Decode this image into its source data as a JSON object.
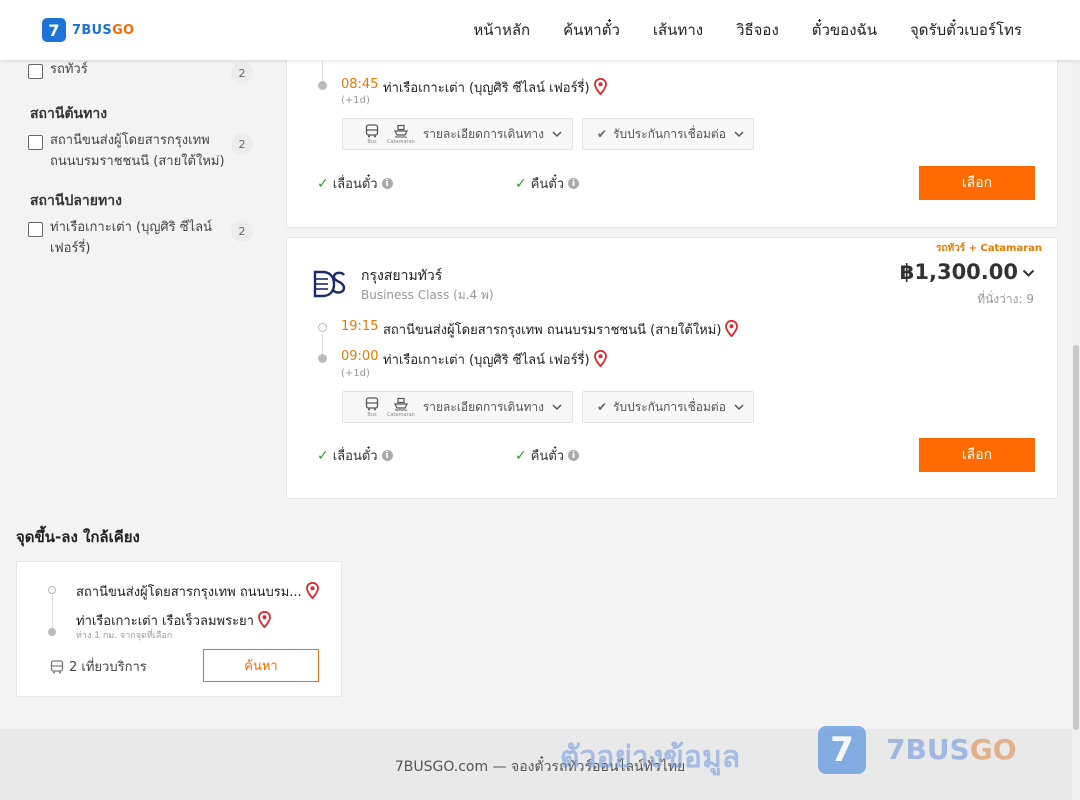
{
  "brand": {
    "logo_mark": "7",
    "name_part1": "7BUS",
    "name_part2": "GO"
  },
  "nav": [
    "หน้าหลัก",
    "ค้นหาตั๋ว",
    "เส้นทาง",
    "วิธีจอง",
    "ตั๋วของฉัน",
    "จุดรับตั๋วเบอร์โทร"
  ],
  "filters": {
    "tour_bus": {
      "label": "รถทัวร์",
      "count": "2"
    },
    "origin_heading": "สถานีต้นทาง",
    "origin": {
      "label": "สถานีขนส่งผู้โดยสารกรุงเทพ ถนนบรมราชชนนี (สายใต้ใหม่)",
      "count": "2"
    },
    "dest_heading": "สถานีปลายทาง",
    "destination": {
      "label": "ท่าเรือเกาะเต่า (บุญศิริ ซีไลน์ เฟอร์รี่)",
      "count": "2"
    }
  },
  "card1": {
    "arrive_time": "08:45",
    "arrive_stop": "ท่าเรือเกาะเต่า (บุญศิริ ซีไลน์ เฟอร์รี่)",
    "next_day": "(+1d)",
    "bus_label": "Bus",
    "boat_label": "Catamaran",
    "details_label": "รายละเอียดการเดินทาง",
    "insurance_label": "รับประกันการเชื่อมต่อ",
    "reschedule": "เลื่อนตั๋ว",
    "refund": "คืนตั๋ว",
    "select": "เลือก"
  },
  "card2": {
    "tag": "รถทัวร์ + Catamaran",
    "operator": "กรุงสยามทัวร์",
    "class": "Business Class (ม.4 พ)",
    "price": "฿1,300.00",
    "seats": "ที่นั่งว่าง: 9",
    "depart_time": "19:15",
    "depart_stop": "สถานีขนส่งผู้โดยสารกรุงเทพ ถนนบรมราชชนนี (สายใต้ใหม่)",
    "arrive_time": "09:00",
    "arrive_stop": "ท่าเรือเกาะเต่า (บุญศิริ ซีไลน์ เฟอร์รี่)",
    "next_day": "(+1d)",
    "bus_label": "Bus",
    "boat_label": "Catamaran",
    "details_label": "รายละเอียดการเดินทาง",
    "insurance_label": "รับประกันการเชื่อมต่อ",
    "reschedule": "เลื่อนตั๋ว",
    "refund": "คืนตั๋ว",
    "select": "เลือก"
  },
  "nearby": {
    "title": "จุดขึ้น-ลง ใกล้เคียง",
    "from_stop": "สถานีขนส่งผู้โดยสารกรุงเทพ ถนนบรม...",
    "to_stop": "ท่าเรือเกาะเต่า เรือเร็วลมพระยา",
    "distance_note": "ห่าง 1 กม. จากจุดที่เลือก",
    "trips": "2 เที่ยวบริการ",
    "search": "ค้นหา"
  },
  "footer": {
    "text": "7BUSGO.com — จองตั๋วรถทัวร์ออนไลน์ทั่วไทย",
    "watermark": "ตัวอย่างข้อมูล",
    "watermark_logo_mark": "7",
    "watermark_brand_part1": "7BUS",
    "watermark_brand_part2": "GO"
  },
  "colors": {
    "accent": "#ff6a00",
    "brand": "#1e73d8",
    "time": "#e87a00",
    "check": "#2a9d3a"
  }
}
